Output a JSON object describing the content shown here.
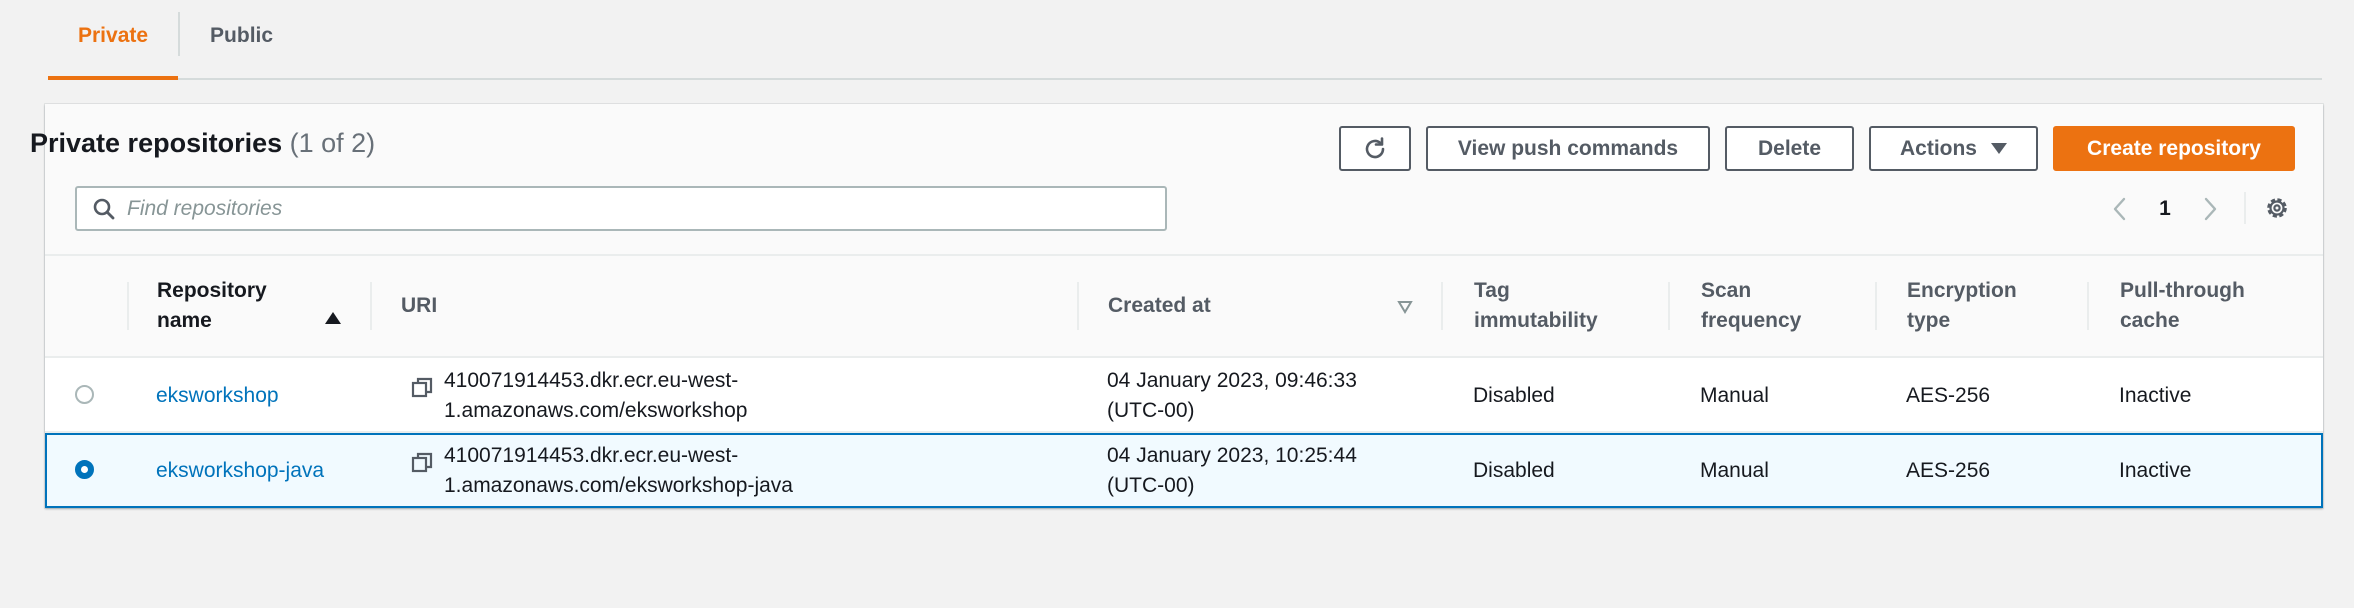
{
  "tabs": [
    {
      "label": "Private",
      "active": true
    },
    {
      "label": "Public",
      "active": false
    }
  ],
  "header": {
    "title": "Private repositories",
    "count": "(1 of 2)"
  },
  "toolbar": {
    "refresh_icon": "refresh-icon",
    "push_label": "View push commands",
    "delete_label": "Delete",
    "actions_label": "Actions",
    "create_label": "Create repository"
  },
  "search": {
    "placeholder": "Find repositories",
    "value": ""
  },
  "pagination": {
    "page": "1"
  },
  "table": {
    "columns": {
      "name": [
        "Repository",
        "name"
      ],
      "uri": "URI",
      "created": "Created at",
      "tag": [
        "Tag",
        "immutability"
      ],
      "scan": [
        "Scan",
        "frequency"
      ],
      "enc": [
        "Encryption",
        "type"
      ],
      "pull": [
        "Pull-through",
        "cache"
      ]
    },
    "rows": [
      {
        "selected": false,
        "name": "eksworkshop",
        "uri": [
          "410071914453.dkr.ecr.eu-west-",
          "1.amazonaws.com/eksworkshop"
        ],
        "created": [
          "04 January 2023, 09:46:33",
          "(UTC-00)"
        ],
        "tag": "Disabled",
        "scan": "Manual",
        "enc": "AES-256",
        "pull": "Inactive"
      },
      {
        "selected": true,
        "name": "eksworkshop-java",
        "uri": [
          "410071914453.dkr.ecr.eu-west-",
          "1.amazonaws.com/eksworkshop-java"
        ],
        "created": [
          "04 January 2023, 10:25:44",
          "(UTC-00)"
        ],
        "tag": "Disabled",
        "scan": "Manual",
        "enc": "AES-256",
        "pull": "Inactive"
      }
    ]
  },
  "colors": {
    "accent": "#ec7211",
    "link": "#0073bb",
    "selected_bg": "#f1faff",
    "page_bg": "#f2f2f2"
  }
}
